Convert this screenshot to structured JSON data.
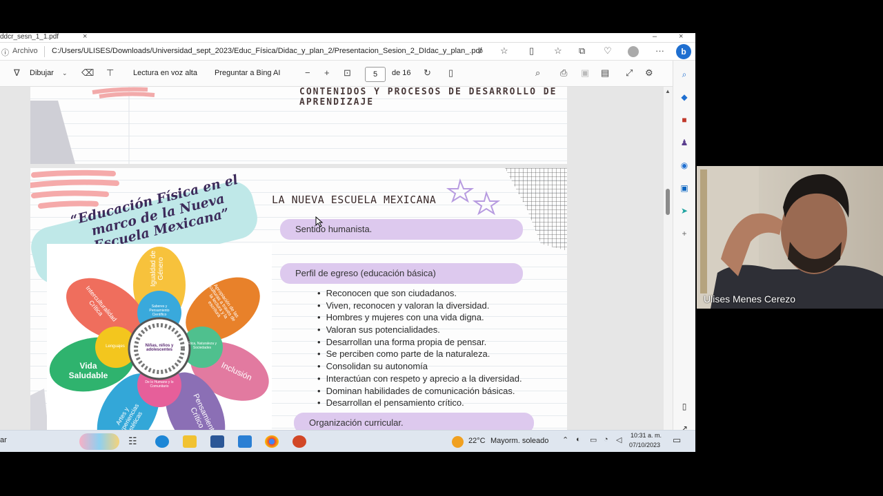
{
  "browser": {
    "tab_title": "ddcr_sesn_1_1.pdf",
    "archivo_label": "Archivo",
    "url": "C:/Users/ULISES/Downloads/Universidad_sept_2023/Educ_Física/Didac_y_plan_2/Presentacion_Sesion_2_DIdac_y_plan_.pdf"
  },
  "pdf_toolbar": {
    "draw_label": "Dibujar",
    "read_aloud_label": "Lectura en voz alta",
    "ask_bing_label": "Preguntar a Bing AI",
    "page_current": "5",
    "page_total": "de 16"
  },
  "slide_prev": {
    "heading": "CONTENIDOS Y PROCESOS DE DESARROLLO DE APRENDIZAJE"
  },
  "slide": {
    "banner_text": "“Educación Física en el marco de la Nueva Escuela Mexicana”",
    "title": "LA NUEVA ESCUELA MEXICANA",
    "pill_1": "Sentido humanista.",
    "pill_2": "Perfil de egreso (educación básica)",
    "bullets": [
      "Reconocen que son ciudadanos.",
      "Viven, reconocen y valoran la diversidad.",
      "Hombres y mujeres con una vida digna.",
      "Valoran sus potencialidades.",
      "Desarrollan una forma propia de pensar.",
      "Se perciben como parte de la naturaleza.",
      "Consolidan su autonomía",
      "Interactúan con respeto y aprecio a la diversidad.",
      "Dominan habilidades de comunicación básicas.",
      "Desarrollan el pensamiento crítico."
    ],
    "pill_3": "Organización curricular.",
    "flower": {
      "center": "Niñas, niños y adolescentes",
      "petals": [
        "Igualdad de Género",
        "Apropiación de las culturas a través de la lectura y la escritura",
        "Inclusión",
        "Pensamiento Crítico",
        "Artes y Experiencias Estéticas",
        "Vida Saludable",
        "Interculturalidad Crítica"
      ],
      "inner": [
        "Saberes y Pensamiento Científico",
        "Ética, Naturaleza y Sociedades",
        "De lo Humano y lo Comunitario",
        "Lenguajes"
      ]
    }
  },
  "taskbar": {
    "search_fragment": "ar",
    "weather_temp": "22°C",
    "weather_desc": "Mayorm. soleado",
    "time": "10:31 a. m.",
    "date": "07/10/2023"
  },
  "webcam": {
    "participant_name": "Ulises Menes Cerezo"
  },
  "colors": {
    "pill": "#ddc9ee",
    "banner": "#bfe8e8",
    "taskbar": "#dfe6ef"
  }
}
